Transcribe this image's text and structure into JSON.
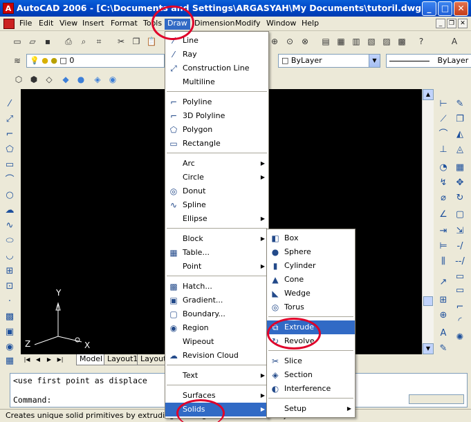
{
  "window": {
    "title": "AutoCAD 2006 - [C:\\Documents and Settings\\ARGASYAH\\My Documents\\tutoril.dwg]",
    "min": "_",
    "max": "□",
    "close": "✕"
  },
  "menubar": {
    "items": [
      "File",
      "Edit",
      "View",
      "Insert",
      "Format",
      "Tools",
      "Draw",
      "Dimension",
      "Modify",
      "Window",
      "Help"
    ],
    "active": "Draw"
  },
  "layers": {
    "current_layer": "0",
    "color_combo": "ByLayer",
    "linetype_combo": "ByLayer"
  },
  "draw_menu": {
    "items": [
      {
        "label": "Line",
        "icon": "line-icon",
        "glyph": "⁄"
      },
      {
        "label": "Ray",
        "icon": "ray-icon",
        "glyph": "⁄"
      },
      {
        "label": "Construction Line",
        "icon": "xline-icon",
        "glyph": "⤢"
      },
      {
        "label": "Multiline",
        "icon": "",
        "glyph": ""
      },
      {
        "label": "Polyline",
        "icon": "polyline-icon",
        "glyph": "⌐"
      },
      {
        "label": "3D Polyline",
        "icon": "3dpolyline-icon",
        "glyph": "⌐"
      },
      {
        "label": "Polygon",
        "icon": "polygon-icon",
        "glyph": "⬠"
      },
      {
        "label": "Rectangle",
        "icon": "rectangle-icon",
        "glyph": "▭"
      },
      {
        "label": "Arc",
        "icon": "",
        "glyph": "",
        "submenu": true
      },
      {
        "label": "Circle",
        "icon": "",
        "glyph": "",
        "submenu": true
      },
      {
        "label": "Donut",
        "icon": "donut-icon",
        "glyph": "◎"
      },
      {
        "label": "Spline",
        "icon": "spline-icon",
        "glyph": "∿"
      },
      {
        "label": "Ellipse",
        "icon": "",
        "glyph": "",
        "submenu": true
      },
      {
        "label": "Block",
        "icon": "",
        "glyph": "",
        "submenu": true
      },
      {
        "label": "Table...",
        "icon": "table-icon",
        "glyph": "▦"
      },
      {
        "label": "Point",
        "icon": "",
        "glyph": "",
        "submenu": true
      },
      {
        "label": "Hatch...",
        "icon": "hatch-icon",
        "glyph": "▩"
      },
      {
        "label": "Gradient...",
        "icon": "gradient-icon",
        "glyph": "▣"
      },
      {
        "label": "Boundary...",
        "icon": "boundary-icon",
        "glyph": "▢"
      },
      {
        "label": "Region",
        "icon": "region-icon",
        "glyph": "◉"
      },
      {
        "label": "Wipeout",
        "icon": "",
        "glyph": ""
      },
      {
        "label": "Revision Cloud",
        "icon": "revcloud-icon",
        "glyph": "☁"
      },
      {
        "label": "Text",
        "icon": "",
        "glyph": "",
        "submenu": true
      },
      {
        "label": "Surfaces",
        "icon": "",
        "glyph": "",
        "submenu": true
      },
      {
        "label": "Solids",
        "icon": "",
        "glyph": "",
        "submenu": true
      }
    ]
  },
  "solids_menu": {
    "items": [
      {
        "label": "Box",
        "icon": "box-icon",
        "glyph": "◧"
      },
      {
        "label": "Sphere",
        "icon": "sphere-icon",
        "glyph": "●"
      },
      {
        "label": "Cylinder",
        "icon": "cylinder-icon",
        "glyph": "▮"
      },
      {
        "label": "Cone",
        "icon": "cone-icon",
        "glyph": "▲"
      },
      {
        "label": "Wedge",
        "icon": "wedge-icon",
        "glyph": "◣"
      },
      {
        "label": "Torus",
        "icon": "torus-icon",
        "glyph": "◎"
      },
      {
        "label": "Extrude",
        "icon": "extrude-icon",
        "glyph": "⧉"
      },
      {
        "label": "Revolve",
        "icon": "revolve-icon",
        "glyph": "↻"
      },
      {
        "label": "Slice",
        "icon": "slice-icon",
        "glyph": "✂"
      },
      {
        "label": "Section",
        "icon": "section-icon",
        "glyph": "◈"
      },
      {
        "label": "Interference",
        "icon": "interference-icon",
        "glyph": "◐"
      },
      {
        "label": "Setup",
        "icon": "",
        "glyph": "",
        "submenu": true
      }
    ],
    "highlighted": "Extrude"
  },
  "layout_tabs": [
    "Model",
    "Layout1",
    "Layout2"
  ],
  "command": {
    "line1": "<use first point as displace",
    "line2": "Command:"
  },
  "status": "Creates unique solid primitives by extruding existing two-dimensional objects",
  "ucs": {
    "x": "X",
    "y": "Y",
    "z": "Z"
  }
}
